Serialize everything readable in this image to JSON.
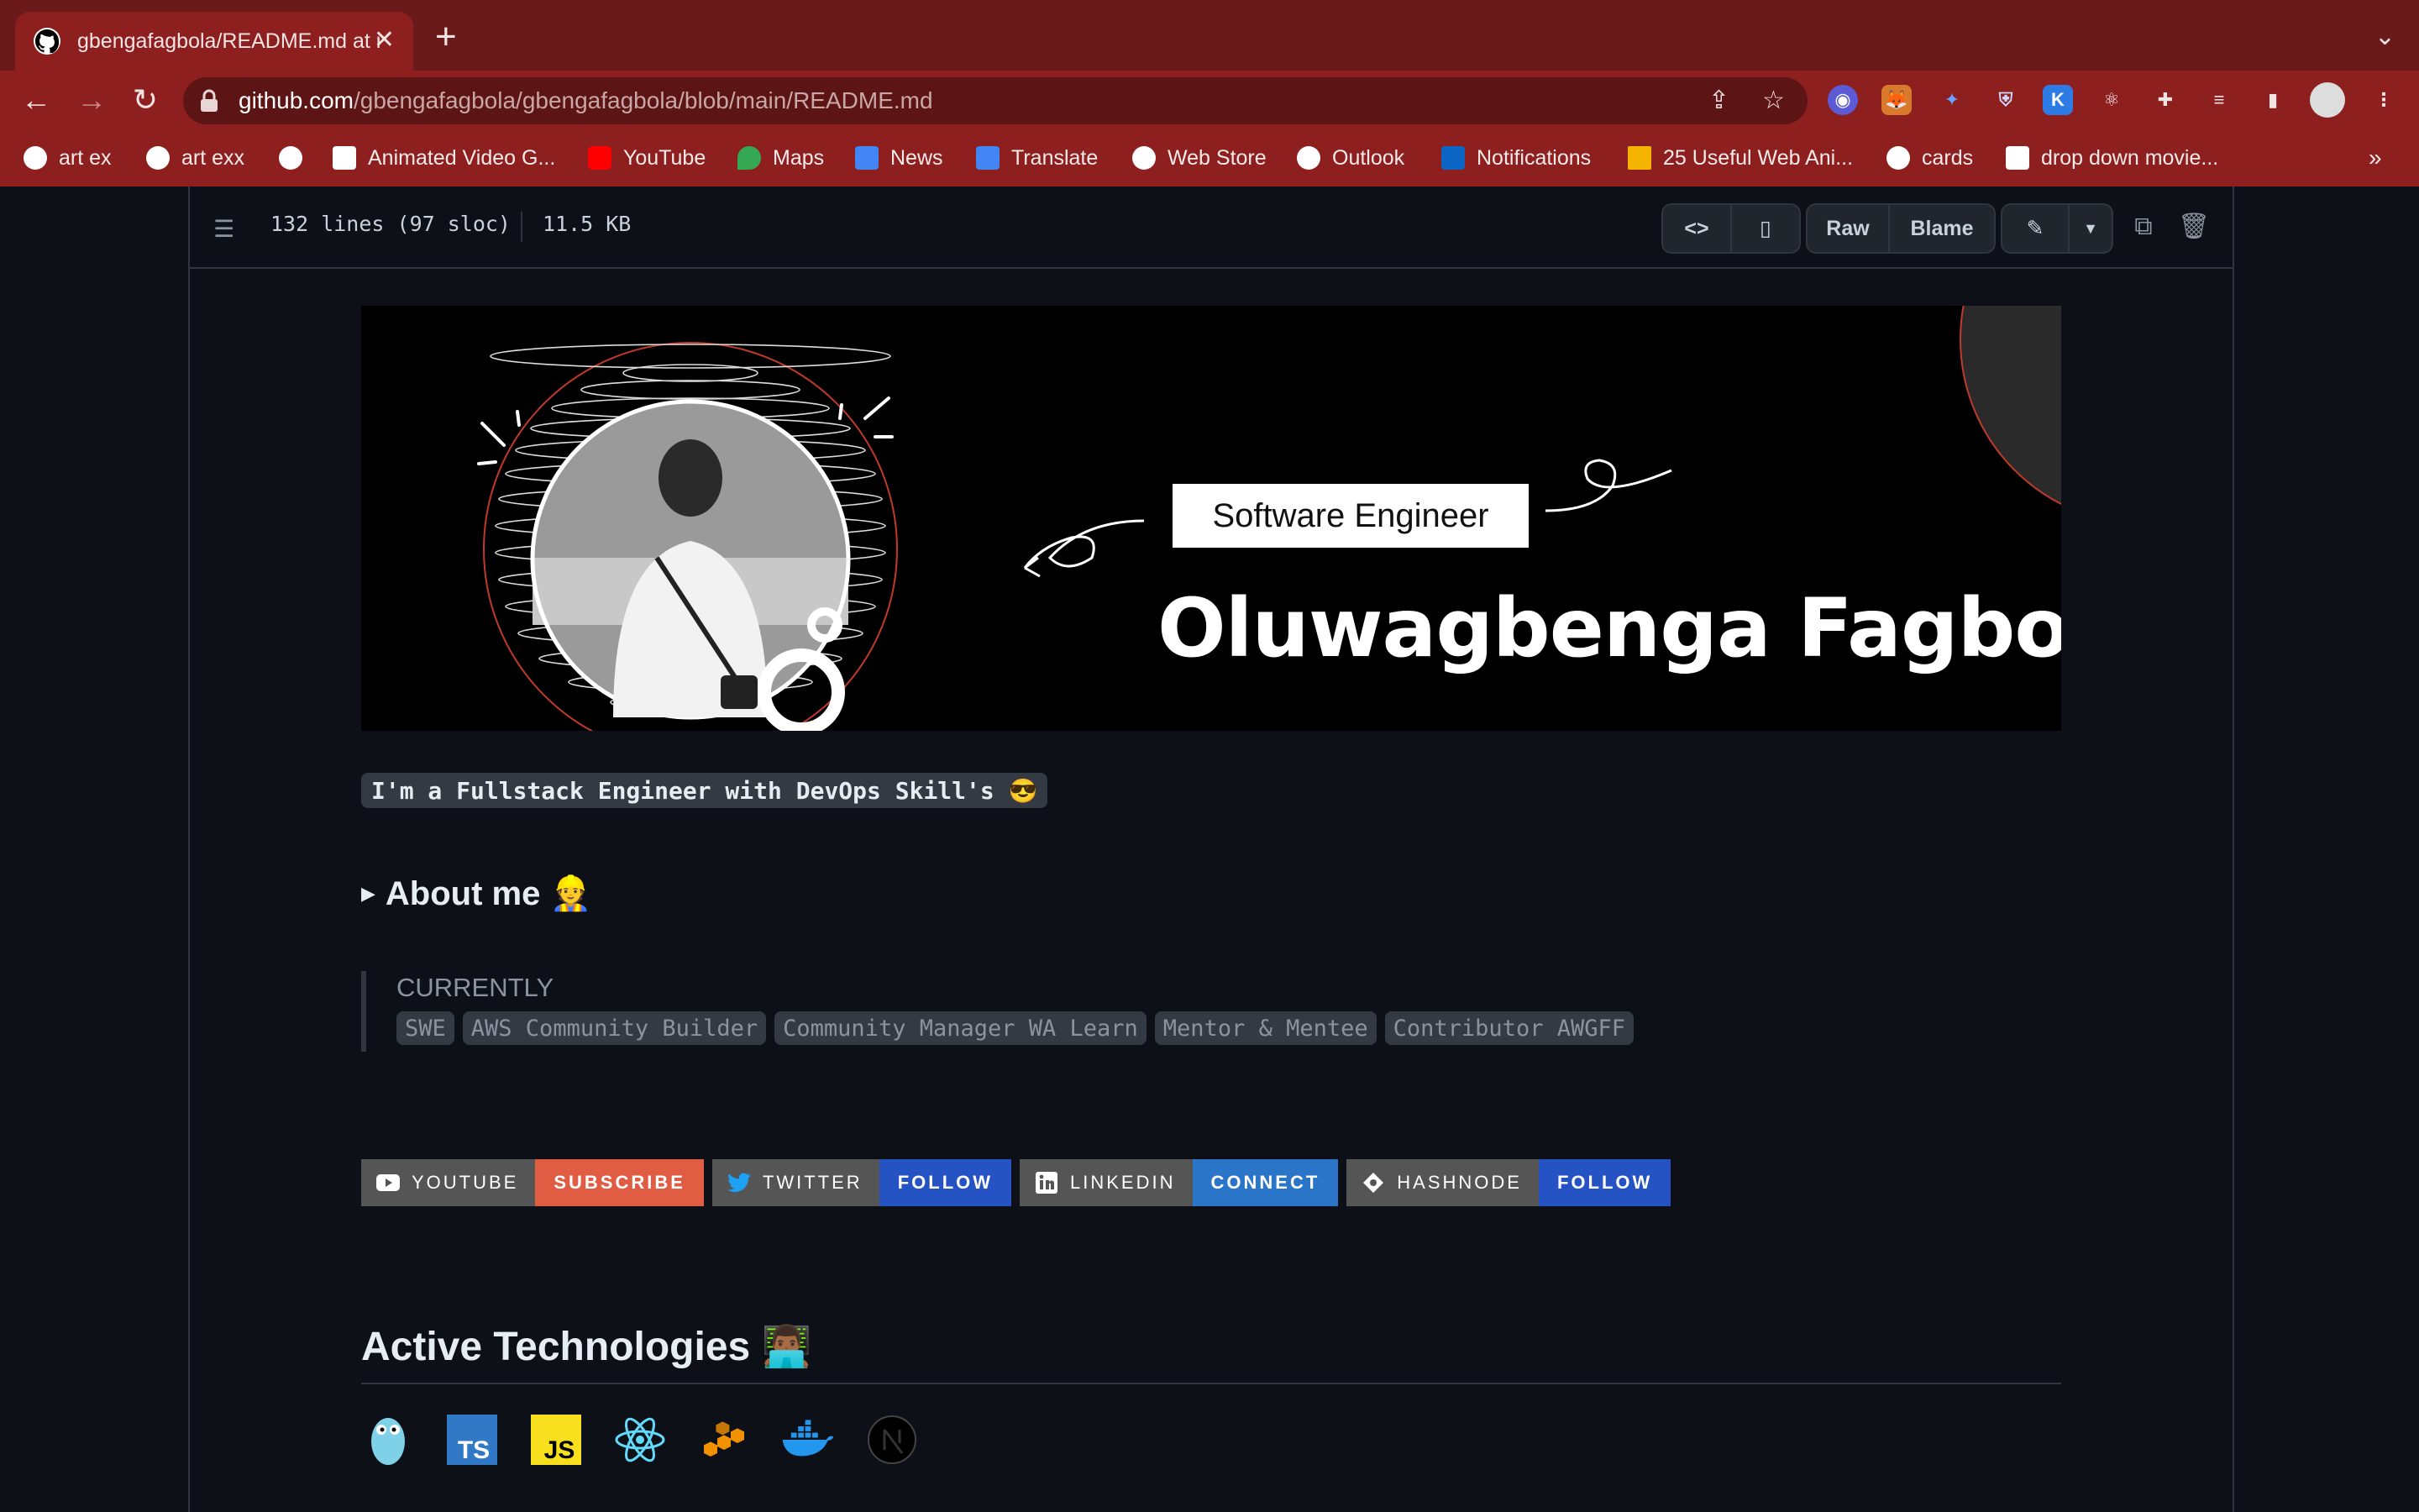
{
  "browser": {
    "tab_title": "gbengafagbola/README.md at main · gbengafagbola/gbengafagbola",
    "url_host": "github.com",
    "url_path": "/gbengafagbola/gbengafagbola/blob/main/README.md",
    "bookmarks": [
      {
        "label": "art ex",
        "icon": "globe-icon"
      },
      {
        "label": "art exx",
        "icon": "globe-icon"
      },
      {
        "label": "",
        "icon": "globe-icon"
      },
      {
        "label": "Animated Video G...",
        "icon": "codepen-icon"
      },
      {
        "label": "YouTube",
        "icon": "youtube-icon"
      },
      {
        "label": "Maps",
        "icon": "maps-icon"
      },
      {
        "label": "News",
        "icon": "news-icon"
      },
      {
        "label": "Translate",
        "icon": "translate-icon"
      },
      {
        "label": "Web Store",
        "icon": "globe-icon"
      },
      {
        "label": "Outlook",
        "icon": "globe-icon"
      },
      {
        "label": "Notifications",
        "icon": "linkedin-icon"
      },
      {
        "label": "25 Useful Web Ani...",
        "icon": "grid-icon"
      },
      {
        "label": "cards",
        "icon": "globe-icon"
      },
      {
        "label": "drop down movie...",
        "icon": "codepen-icon"
      }
    ]
  },
  "file": {
    "lines": "132 lines (97 sloc)",
    "size": "11.5 KB",
    "raw_label": "Raw",
    "blame_label": "Blame"
  },
  "readme": {
    "banner_role": "Software Engineer",
    "banner_name": "Oluwagbenga Fagbola",
    "intro": "I'm a Fullstack Engineer with DevOps Skill's 😎",
    "about_title": "About me 👷",
    "currently_label": "CURRENTLY",
    "currently_chips": [
      "SWE",
      "AWS Community Builder",
      "Community Manager WA Learn",
      "Mentor & Mentee",
      "Contributor AWGFF"
    ],
    "badges": [
      {
        "left": "YOUTUBE",
        "right": "SUBSCRIBE",
        "color": "#e05d44",
        "icon": "youtube-icon"
      },
      {
        "left": "TWITTER",
        "right": "FOLLOW",
        "color": "#2553c4",
        "icon": "twitter-icon"
      },
      {
        "left": "LINKEDIN",
        "right": "CONNECT",
        "color": "#2a75c7",
        "icon": "linkedin-icon"
      },
      {
        "left": "HASHNODE",
        "right": "FOLLOW",
        "color": "#2553c4",
        "icon": "hashnode-icon"
      }
    ],
    "tech_heading": "Active Technologies 👨🏾‍💻",
    "techs": [
      "go-icon",
      "typescript-icon",
      "javascript-icon",
      "react-icon",
      "aws-icon",
      "docker-icon",
      "nextjs-icon"
    ]
  }
}
